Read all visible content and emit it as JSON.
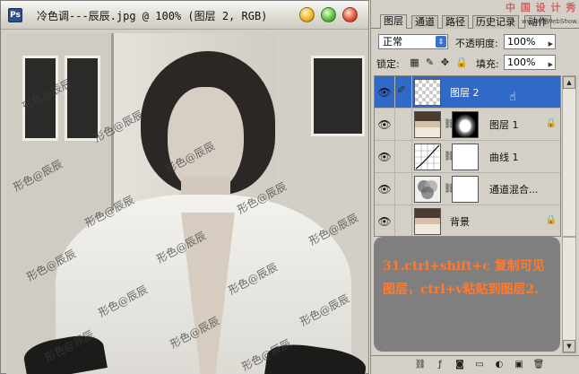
{
  "document": {
    "title": "冷色调---辰辰.jpg @ 100% (图层 2, RGB)",
    "app_icon": "Ps",
    "watermark": "形色@辰辰"
  },
  "panel": {
    "tabs": [
      "图层",
      "通道",
      "路径",
      "历史记录",
      "动作"
    ],
    "active_tab": "图层",
    "site_logo": "中 国 设 计 秀",
    "site_url": "www.EnWebShow.com",
    "blend_mode": "正常",
    "opacity_label": "不透明度:",
    "opacity_value": "100%",
    "lock_label": "锁定:",
    "fill_label": "填充:",
    "fill_value": "100%",
    "layers": [
      {
        "name": "图层 2",
        "selected": true,
        "thumb": "transparent"
      },
      {
        "name": "图层 1",
        "selected": false,
        "thumb": "photo",
        "mask": "vignette"
      },
      {
        "name": "曲线 1",
        "selected": false,
        "thumb": "curves",
        "mask": "white"
      },
      {
        "name": "通道混合...",
        "selected": false,
        "thumb": "mixer",
        "mask": "white"
      },
      {
        "name": "背景",
        "selected": false,
        "thumb": "photo"
      }
    ],
    "note": "31.ctrl+shift+c 复制可见图层，ctrl+v粘贴到图层2."
  },
  "colors": {
    "selection": "#3169c6",
    "note_bg": "#7f7f7f",
    "note_text": "#ff7a2e"
  }
}
